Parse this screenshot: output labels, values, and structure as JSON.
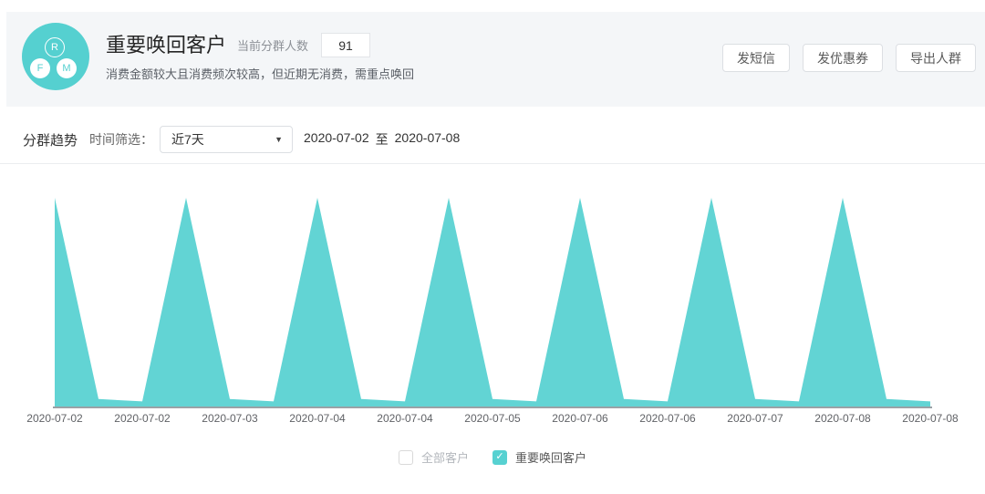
{
  "header": {
    "avatar": {
      "r": "R",
      "f": "F",
      "m": "M"
    },
    "title": "重要唤回客户",
    "count_label": "当前分群人数",
    "count_value": "91",
    "description": "消费金额较大且消费频次较高，但近期无消费，需重点唤回",
    "actions": [
      {
        "id": "send-sms",
        "label": "发短信"
      },
      {
        "id": "send-coupon",
        "label": "发优惠券"
      },
      {
        "id": "export-audience",
        "label": "导出人群"
      }
    ]
  },
  "filter": {
    "section_title": "分群趋势",
    "time_label": "时间筛选：",
    "time_value": "近7天",
    "date_start": "2020-07-02",
    "date_sep": "至",
    "date_end": "2020-07-08"
  },
  "icons": {
    "caret_down": "▼",
    "check": "✓"
  },
  "colors": {
    "accent": "#57d1d1",
    "chart_fill": "#62d4d4",
    "header_bg": "#f4f6f8",
    "axis_line": "#9aa1a6"
  },
  "chart_data": {
    "type": "area",
    "title": "分群趋势",
    "x_labels": [
      "2020-07-02",
      "2020-07-02",
      "2020-07-03",
      "2020-07-04",
      "2020-07-04",
      "2020-07-05",
      "2020-07-06",
      "2020-07-06",
      "2020-07-07",
      "2020-07-08",
      "2020-07-08"
    ],
    "x_label_every_n_points": 2,
    "series": [
      {
        "name": "重要唤回客户",
        "color": "#62d4d4",
        "values": [
          91,
          4,
          3,
          91,
          4,
          3,
          91,
          4,
          3,
          91,
          4,
          3,
          91,
          4,
          3,
          91,
          4,
          3,
          91,
          4,
          3
        ]
      }
    ],
    "y_range": [
      0,
      91
    ],
    "grid": false,
    "legend_position": "bottom",
    "legend": [
      {
        "id": "all-customers",
        "label": "全部客户",
        "checked": false
      },
      {
        "id": "recall-customers",
        "label": "重要唤回客户",
        "checked": true
      }
    ]
  }
}
